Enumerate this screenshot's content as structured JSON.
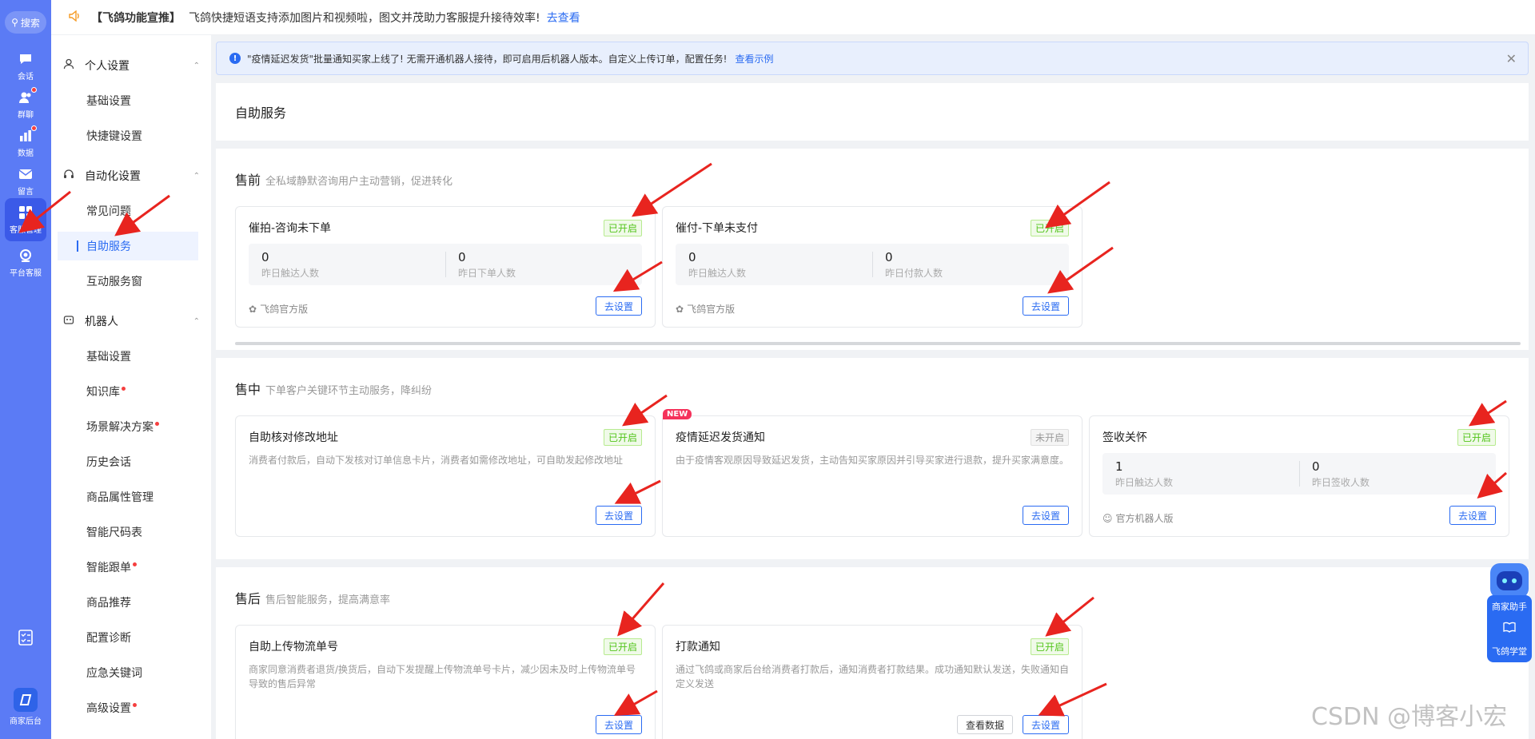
{
  "rail": {
    "search": "搜索",
    "items": [
      {
        "label": "会话",
        "icon": "chat-icon"
      },
      {
        "label": "群聊",
        "icon": "group-icon"
      },
      {
        "label": "数据",
        "icon": "chart-icon"
      },
      {
        "label": "留言",
        "icon": "mail-icon"
      },
      {
        "label": "客服管理",
        "icon": "grid-icon"
      },
      {
        "label": "平台客服",
        "icon": "headset-icon"
      },
      {
        "label": "商家后台",
        "icon": "store-icon"
      }
    ]
  },
  "topbar": {
    "tag": "【飞鸽功能宣推】",
    "text": "飞鸽快捷短语支持添加图片和视频啦，图文并茂助力客服提升接待效率!",
    "link": "去查看"
  },
  "nav": {
    "personal": "个人设置",
    "personal_items": [
      "基础设置",
      "快捷键设置"
    ],
    "automation": "自动化设置",
    "automation_items": [
      "常见问题",
      "自助服务",
      "互动服务窗"
    ],
    "robot": "机器人",
    "robot_items": [
      "基础设置",
      "知识库",
      "场景解决方案",
      "历史会话",
      "商品属性管理",
      "智能尺码表",
      "智能跟单",
      "商品推荐",
      "配置诊断",
      "应急关键词",
      "高级设置"
    ]
  },
  "notice": {
    "text": "\"疫情延迟发货\"批量通知买家上线了! 无需开通机器人接待，即可启用后机器人版本。自定义上传订单，配置任务!",
    "link": "查看示例"
  },
  "page_title": "自助服务",
  "presale": {
    "title": "售前",
    "subtitle": "全私域静默咨询用户主动营销，促进转化",
    "cards": [
      {
        "title": "催拍-咨询未下单",
        "status": "已开启",
        "v1": "0",
        "l1": "昨日触达人数",
        "v2": "0",
        "l2": "昨日下单人数",
        "version": "飞鸽官方版",
        "btn": "去设置"
      },
      {
        "title": "催付-下单未支付",
        "status": "已开启",
        "v1": "0",
        "l1": "昨日触达人数",
        "v2": "0",
        "l2": "昨日付款人数",
        "version": "飞鸽官方版",
        "btn": "去设置"
      }
    ]
  },
  "insale": {
    "title": "售中",
    "subtitle": "下单客户关键环节主动服务，降纠纷",
    "cards": [
      {
        "title": "自助核对修改地址",
        "status": "已开启",
        "desc": "消费者付款后，自动下发核对订单信息卡片，消费者如需修改地址，可自助发起修改地址",
        "btn": "去设置"
      },
      {
        "title": "疫情延迟发货通知",
        "status": "未开启",
        "badge": "NEW",
        "desc": "由于疫情客观原因导致延迟发货，主动告知买家原因并引导买家进行退款，提升买家满意度。",
        "btn": "去设置"
      },
      {
        "title": "签收关怀",
        "status": "已开启",
        "v1": "1",
        "l1": "昨日触达人数",
        "v2": "0",
        "l2": "昨日签收人数",
        "version": "官方机器人版",
        "btn": "去设置"
      }
    ]
  },
  "aftersale": {
    "title": "售后",
    "subtitle": "售后智能服务，提高满意率",
    "cards": [
      {
        "title": "自助上传物流单号",
        "status": "已开启",
        "desc": "商家同意消费者退货/换货后，自动下发提醒上传物流单号卡片，减少因未及时上传物流单号导致的售后异常",
        "btn": "去设置"
      },
      {
        "title": "打款通知",
        "status": "已开启",
        "desc": "通过飞鸽或商家后台给消费者打款后，通知消费者打款结果。成功通知默认发送，失败通知自定义发送",
        "btn": "去设置",
        "btn2": "查看数据"
      }
    ]
  },
  "helper": {
    "label1": "商家助手",
    "label2": "飞鸽学堂"
  },
  "watermark": "CSDN @博客小宏",
  "colors": {
    "accent": "#2a6bf2",
    "rail": "#5b7bf5",
    "on": "#52c41a",
    "arrow": "#e8241f"
  }
}
